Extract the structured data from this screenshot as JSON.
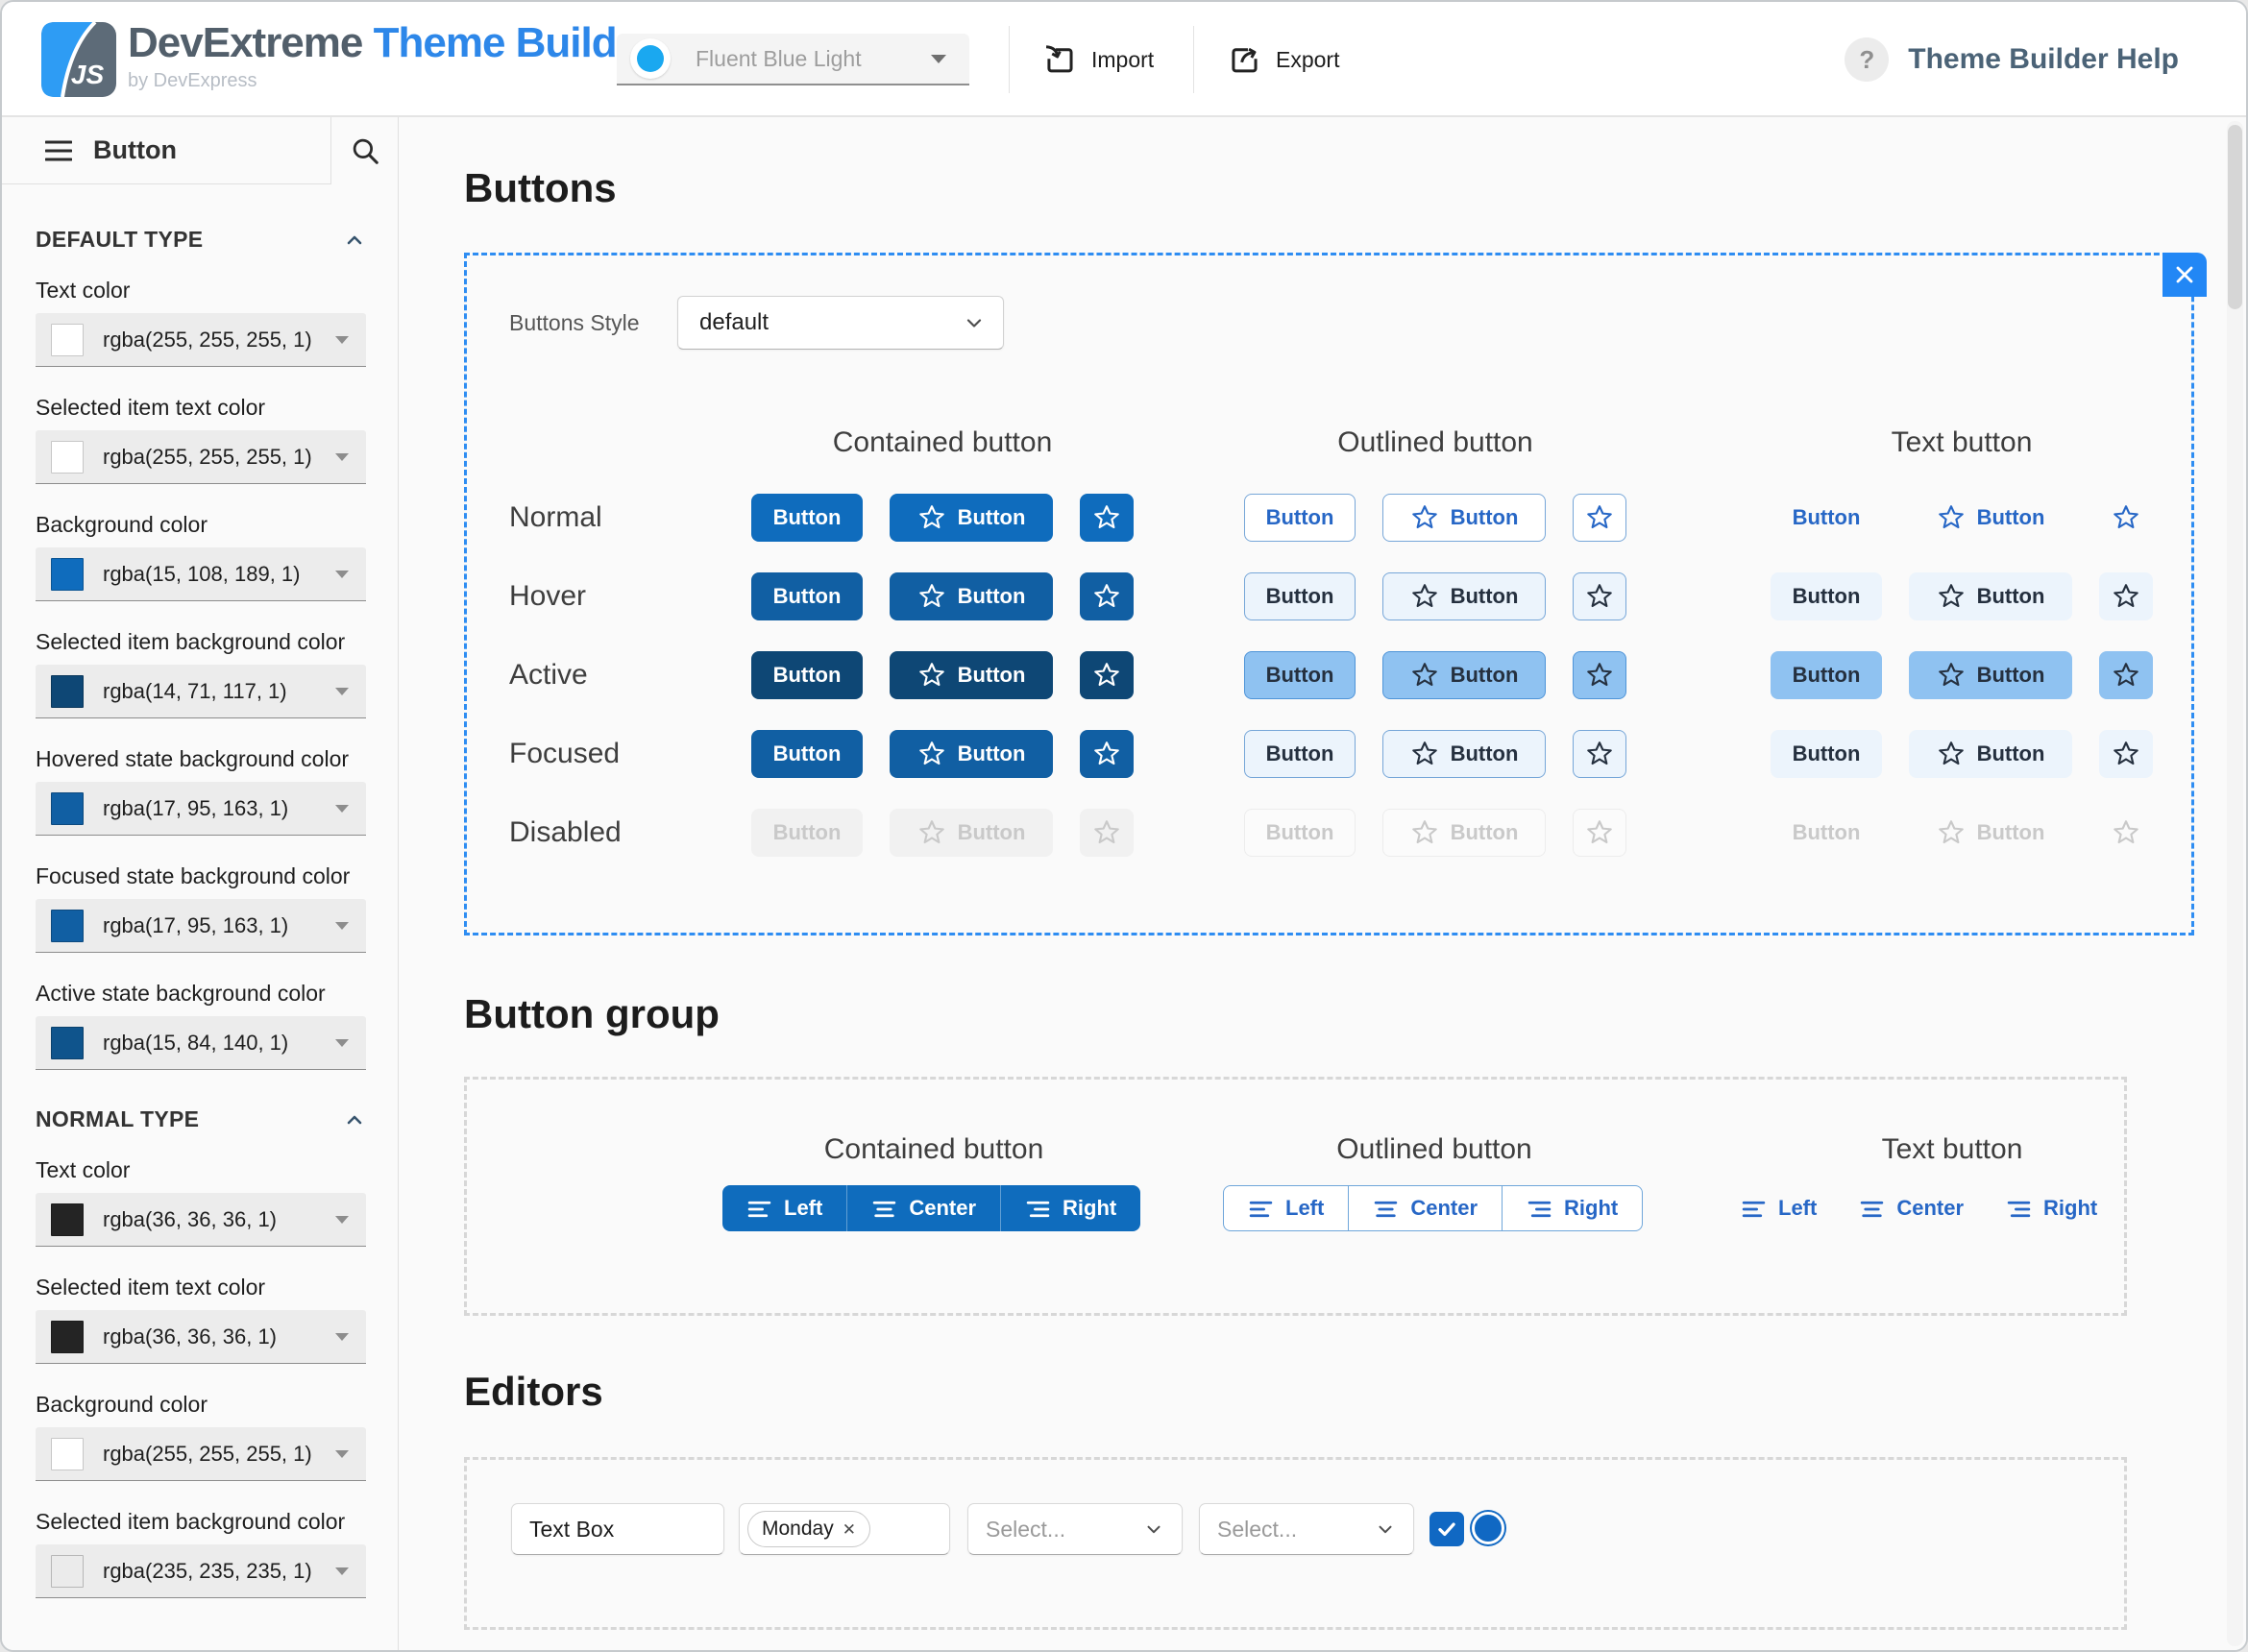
{
  "header": {
    "logo_js": "JS",
    "brand": "DevExtreme",
    "product": "Theme Builder",
    "byline": "by DevExpress",
    "theme_select": {
      "value": "Fluent Blue Light"
    },
    "import_label": "Import",
    "export_label": "Export",
    "help_icon": "?",
    "help_label": "Theme Builder Help"
  },
  "sidebar": {
    "widget_title": "Button",
    "sections": [
      {
        "title": "DEFAULT TYPE",
        "collapsed": false,
        "fields": [
          {
            "label": "Text color",
            "value": "rgba(255, 255, 255, 1)",
            "swatch": "#ffffff"
          },
          {
            "label": "Selected item text color",
            "value": "rgba(255, 255, 255, 1)",
            "swatch": "#ffffff"
          },
          {
            "label": "Background color",
            "value": "rgba(15, 108, 189, 1)",
            "swatch": "#0f6cbd"
          },
          {
            "label": "Selected item background color",
            "value": "rgba(14, 71, 117, 1)",
            "swatch": "#0e4775"
          },
          {
            "label": "Hovered state background color",
            "value": "rgba(17, 95, 163, 1)",
            "swatch": "#115fa3"
          },
          {
            "label": "Focused state background color",
            "value": "rgba(17, 95, 163, 1)",
            "swatch": "#115fa3"
          },
          {
            "label": "Active state background color",
            "value": "rgba(15, 84, 140, 1)",
            "swatch": "#0f548c"
          }
        ]
      },
      {
        "title": "NORMAL TYPE",
        "collapsed": false,
        "fields": [
          {
            "label": "Text color",
            "value": "rgba(36, 36, 36, 1)",
            "swatch": "#242424"
          },
          {
            "label": "Selected item text color",
            "value": "rgba(36, 36, 36, 1)",
            "swatch": "#242424"
          },
          {
            "label": "Background color",
            "value": "rgba(255, 255, 255, 1)",
            "swatch": "#ffffff"
          },
          {
            "label": "Selected item background color",
            "value": "rgba(235, 235, 235, 1)",
            "swatch": "#ebebeb"
          }
        ]
      }
    ]
  },
  "buttons_section": {
    "heading": "Buttons",
    "style_label": "Buttons Style",
    "style_value": "default",
    "columns": [
      "Contained button",
      "Outlined button",
      "Text button"
    ],
    "states": [
      "Normal",
      "Hover",
      "Active",
      "Focused",
      "Disabled"
    ],
    "button_label": "Button"
  },
  "button_group_section": {
    "heading": "Button group",
    "columns": [
      "Contained button",
      "Outlined button",
      "Text button"
    ],
    "items": [
      "Left",
      "Center",
      "Right"
    ]
  },
  "editors_section": {
    "heading": "Editors",
    "textbox_value": "Text Box",
    "tag_label": "Monday",
    "select_placeholder": "Select...",
    "checkbox_checked": true,
    "radio_selected": true
  },
  "colors": {
    "accent": "#0f6cbd",
    "accent_hover": "#115fa3",
    "accent_active": "#0e4775",
    "brand_blue": "#2d87e9",
    "logo_blue": "#2e9cf4",
    "logo_gray": "#5d6b78",
    "theme_dot": "#1aa8f0",
    "selection_dash": "#2e8df2",
    "link_blue": "#2767c6",
    "help_text": "#4b6377"
  }
}
